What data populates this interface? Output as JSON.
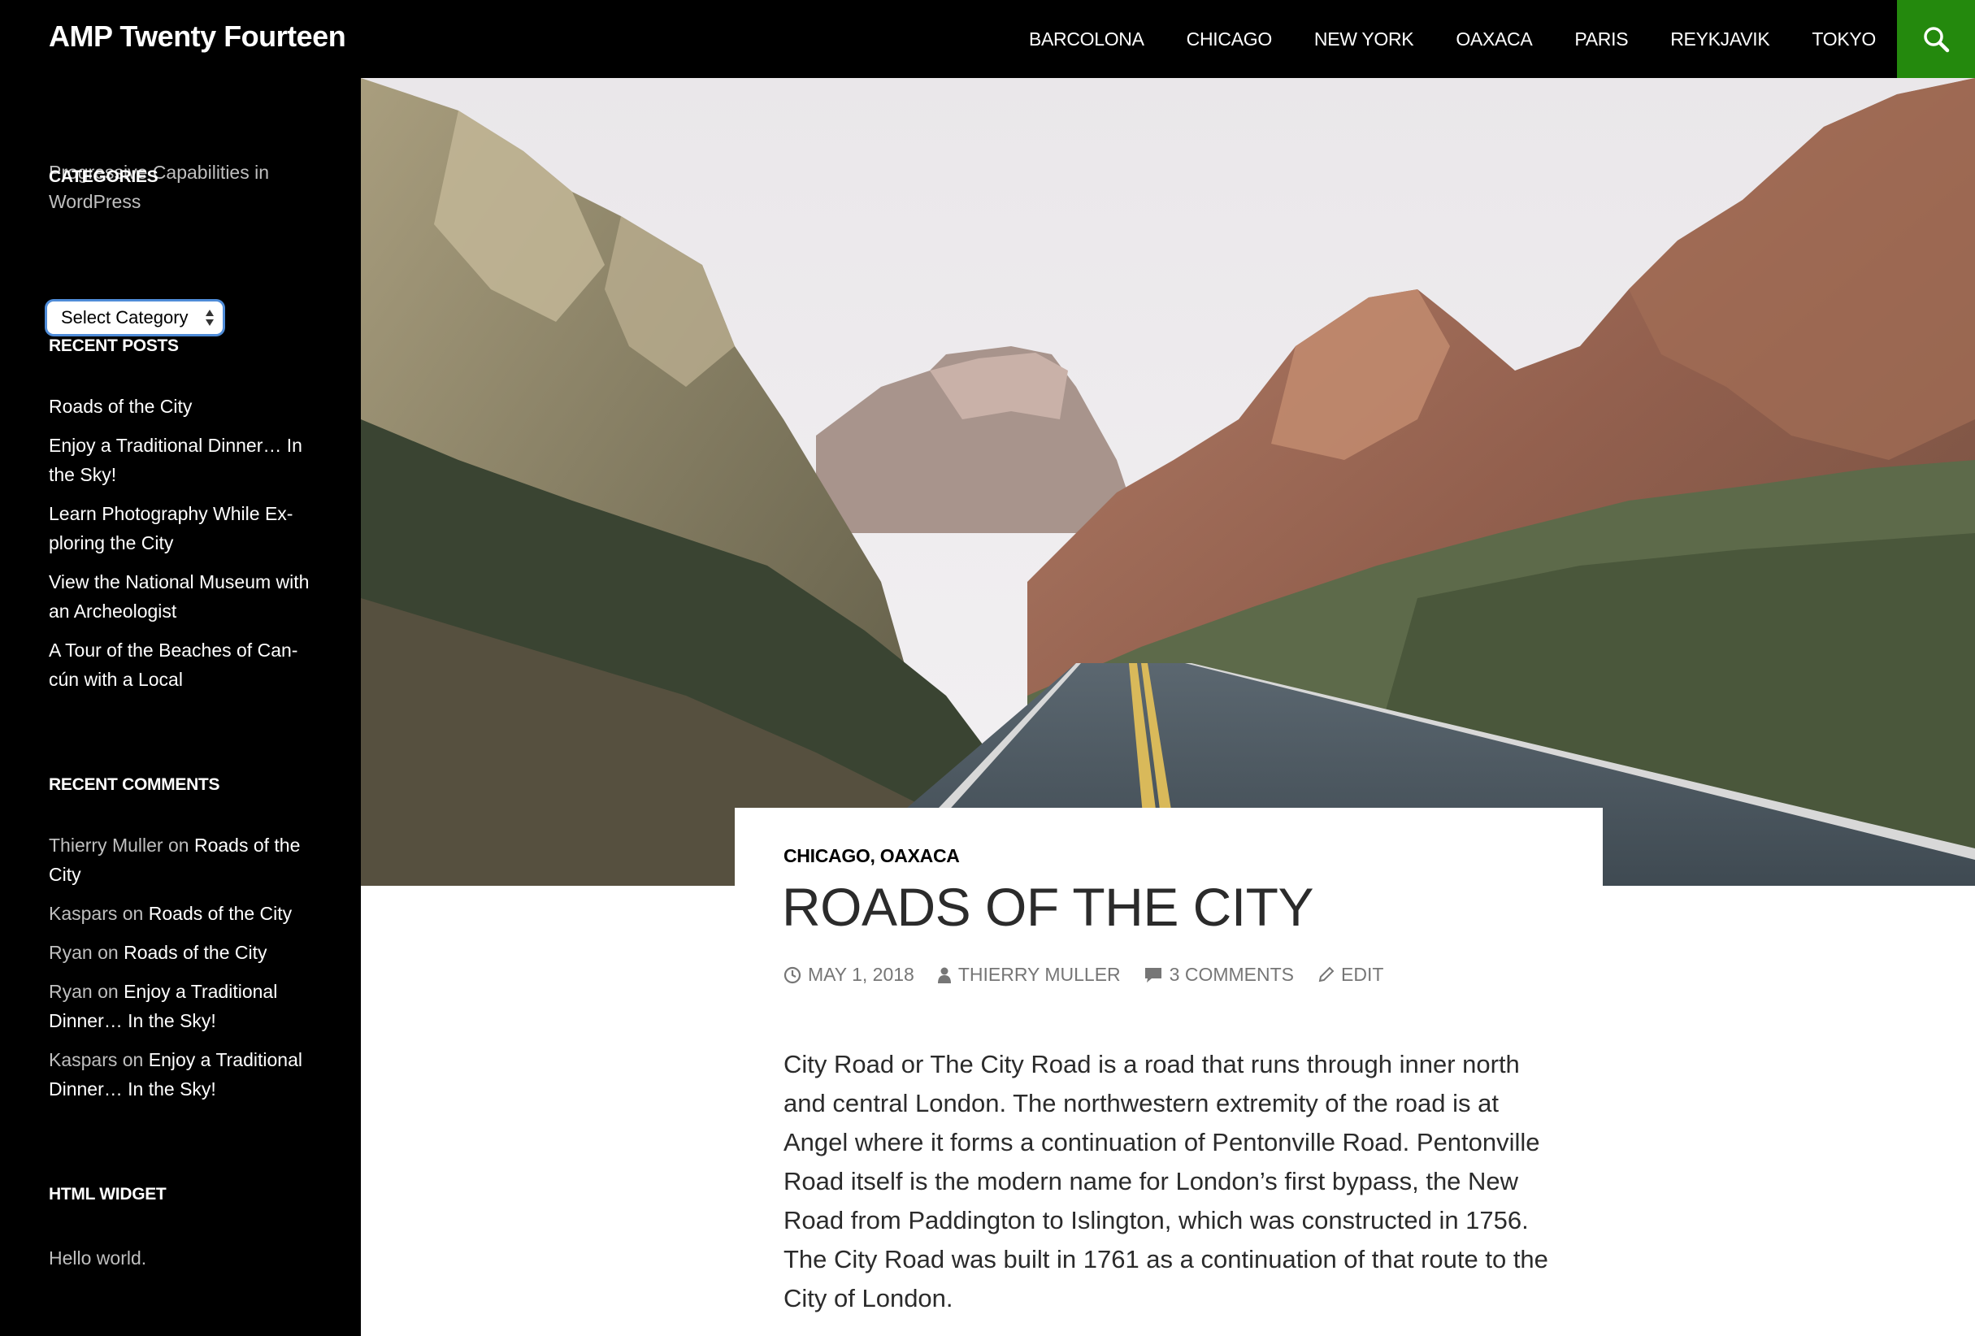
{
  "site": {
    "title": "AMP Twenty Fourteen",
    "description": "Progressive Capabilities in WordPress"
  },
  "nav": {
    "items": [
      {
        "label": "BARCOLONA"
      },
      {
        "label": "CHICAGO"
      },
      {
        "label": "NEW YORK"
      },
      {
        "label": "OAXACA"
      },
      {
        "label": "PARIS"
      },
      {
        "label": "REYKJAVIK"
      },
      {
        "label": "TOKYO"
      }
    ],
    "search_icon": "search-icon"
  },
  "sidebar": {
    "categories": {
      "title": "CATEGORIES",
      "select_value": "Select Category"
    },
    "recent_posts": {
      "title": "RECENT POSTS",
      "items": [
        {
          "label": "Roads of the City"
        },
        {
          "label": "Enjoy a Traditional Dinner… In the Sky!"
        },
        {
          "label": "Learn Photography While Ex­ploring the City"
        },
        {
          "label": "View the National Museum with an Archeologist"
        },
        {
          "label": "A Tour of the Beaches of Can­cún with a Local"
        }
      ]
    },
    "recent_comments": {
      "title": "RECENT COMMENTS",
      "items": [
        {
          "author": "Thierry Muller",
          "on": " on ",
          "post": "Roads of the City"
        },
        {
          "author": "Kaspars",
          "on": " on ",
          "post": "Roads of the City"
        },
        {
          "author": "Ryan",
          "on": " on ",
          "post": "Roads of the City"
        },
        {
          "author": "Ryan",
          "on": " on ",
          "post": "Enjoy a Traditional Dinner… In the Sky!"
        },
        {
          "author": "Kaspars",
          "on": " on ",
          "post": "Enjoy a Traditional Dinner… In the Sky!"
        }
      ]
    },
    "html_widget": {
      "title": "HTML WIDGET",
      "text": "Hello world."
    }
  },
  "post": {
    "categories": [
      {
        "label": "CHICAGO"
      },
      {
        "label": "OAXACA"
      }
    ],
    "category_separator": ",",
    "title": "ROADS OF THE CITY",
    "meta": {
      "date": "MAY 1, 2018",
      "author": "THIERRY MULLER",
      "comments": "3 COMMENTS",
      "edit": "EDIT"
    },
    "content": "City Road or The City Road is a road that runs through inner north and central London. The northwestern extremity of the road is at Angel where it forms a continuation of Pentonville Road. Pentonville Road itself is the modern name for London’s first bypass, the New Road from Paddington to Islington, which was constructed in 1756. The City Road was built in 1761 as a continuation of that route to the City of London."
  },
  "colors": {
    "header_bg": "#000000",
    "accent_green": "#24890d",
    "sidebar_muted_text": "#bfbfbf",
    "meta_gray": "#767676",
    "title_text": "#2b2b2b"
  }
}
